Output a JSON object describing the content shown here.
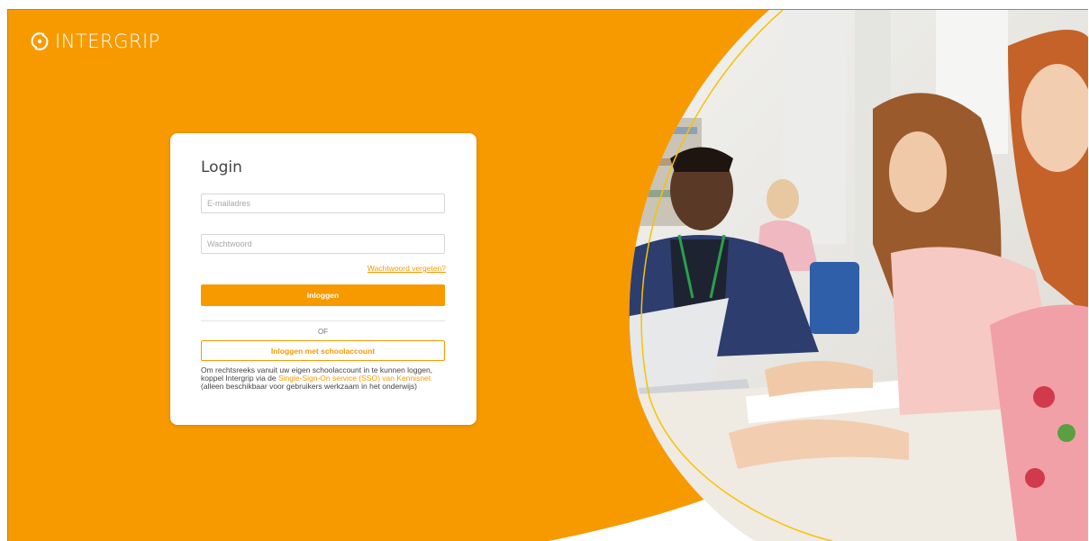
{
  "brand": {
    "name": "INTERGRIP",
    "primary_color": "#f79a00"
  },
  "login": {
    "title": "Login",
    "email_placeholder": "E-mailadres",
    "password_placeholder": "Wachtwoord",
    "forgot_link": "Wachtwoord vergeten?",
    "login_button": "Inloggen",
    "or_label": "OF",
    "school_button": "Inloggen met schoolaccount",
    "info_text_before": "Om rechtsreeks vanuit uw eigen schoolaccount in te kunnen loggen, koppel Intergrip via de ",
    "info_link": "Single-Sign-On service (SSO) van Kennisnet",
    "info_text_after": " (alleen beschikbaar voor gebruikers werkzaam in het onderwijs)"
  },
  "hero_image": {
    "icon": "students-photo"
  }
}
